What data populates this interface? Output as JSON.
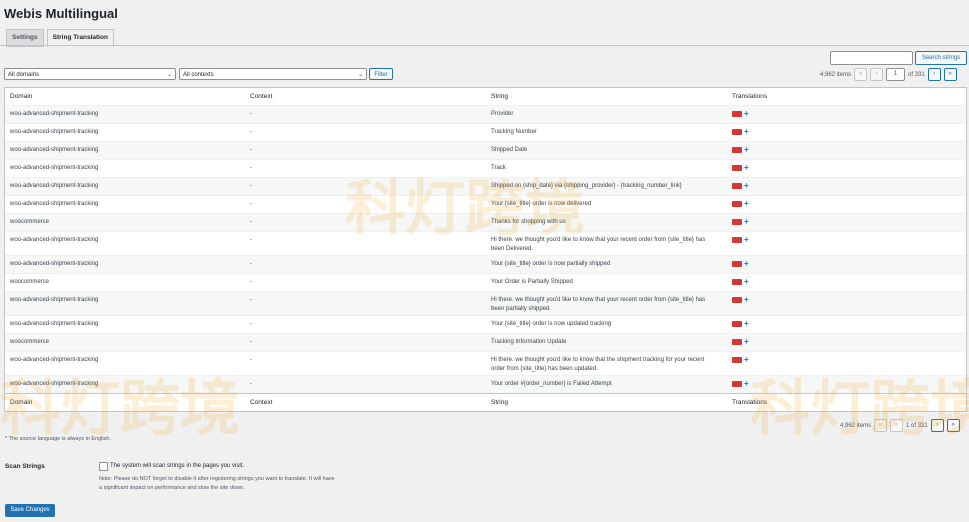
{
  "page": {
    "title": "Webis Multilingual"
  },
  "tabs": [
    {
      "label": "Settings",
      "active": false
    },
    {
      "label": "String Translation",
      "active": true
    }
  ],
  "search": {
    "button_label": "Search strings",
    "value": ""
  },
  "filters": {
    "domain_selected": "All domains",
    "context_selected": "All contexts",
    "filter_label": "Filter"
  },
  "pagination_top": {
    "items": "4,962 items",
    "current_page": "1",
    "of_total": "of 331",
    "first": "«",
    "prev": "‹",
    "next": "›",
    "last": "»"
  },
  "pagination_bottom": {
    "items": "4,962 items",
    "page_text": "1 of 331",
    "first": "«",
    "prev": "‹",
    "next": "›",
    "last": "»"
  },
  "table": {
    "columns": [
      "Domain",
      "Context",
      "String",
      "Translations"
    ],
    "rows": [
      {
        "domain": "woo-advanced-shipment-tracking",
        "context": "-",
        "string": "Provider"
      },
      {
        "domain": "woo-advanced-shipment-tracking",
        "context": "-",
        "string": "Tracking Number"
      },
      {
        "domain": "woo-advanced-shipment-tracking",
        "context": "-",
        "string": "Shipped Date"
      },
      {
        "domain": "woo-advanced-shipment-tracking",
        "context": "-",
        "string": "Track"
      },
      {
        "domain": "woo-advanced-shipment-tracking",
        "context": "-",
        "string": "Shipped on {ship_date} via {shipping_provider} - {tracking_number_link}"
      },
      {
        "domain": "woo-advanced-shipment-tracking",
        "context": "-",
        "string": "Your {site_title} order is now delivered"
      },
      {
        "domain": "woocommerce",
        "context": "-",
        "string": "Thanks for shopping with us"
      },
      {
        "domain": "woo-advanced-shipment-tracking",
        "context": "-",
        "string": "Hi there. we thought you'd like to know that your recent order from {site_title} has been Delivered."
      },
      {
        "domain": "woo-advanced-shipment-tracking",
        "context": "-",
        "string": "Your {site_title} order is now partially shipped"
      },
      {
        "domain": "woocommerce",
        "context": "-",
        "string": "Your Order is Partially Shipped"
      },
      {
        "domain": "woo-advanced-shipment-tracking",
        "context": "-",
        "string": "Hi there. we thought you'd like to know that your recent order from {site_title} has been partially shipped."
      },
      {
        "domain": "woo-advanced-shipment-tracking",
        "context": "-",
        "string": "Your {site_title} order is now updated tracking"
      },
      {
        "domain": "woocommerce",
        "context": "-",
        "string": "Tracking Information Update"
      },
      {
        "domain": "woo-advanced-shipment-tracking",
        "context": "-",
        "string": "Hi there. we thought you'd like to know that the shipment tracking for your recent order from {site_title} has been updated."
      },
      {
        "domain": "woo-advanced-shipment-tracking",
        "context": "-",
        "string": "Your order #{order_number} is Failed Attempt"
      }
    ],
    "translation_icon": "flag-icon",
    "add_icon": "+"
  },
  "footer": {
    "source_note": "* The source language is always in English.",
    "scan_label": "Scan Strings",
    "scan_checkbox_text": "The system will scan strings in the pages you visit.",
    "scan_note": "Note: Please do NOT forget to disable it after registering strings you want to translate. It will have a significant impact on performance and slow the site down.",
    "save_label": "Save Changes"
  },
  "watermark": {
    "text_cn": "科灯跨境"
  },
  "colors": {
    "primary": "#2271b1",
    "flag": "#d63638",
    "background": "#f0f0f1"
  }
}
